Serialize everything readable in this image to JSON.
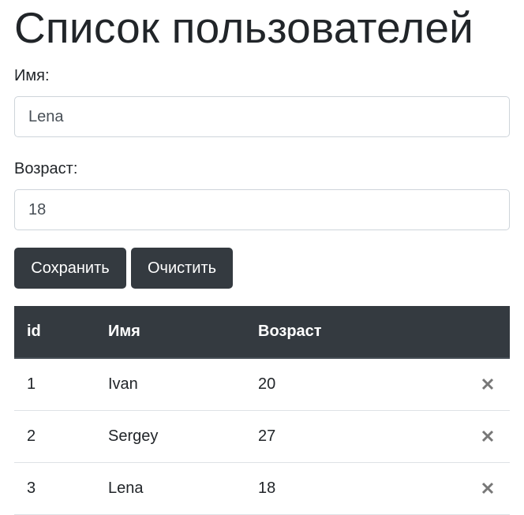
{
  "page": {
    "title": "Список пользователей"
  },
  "form": {
    "name_label": "Имя:",
    "name_value": "Lena",
    "age_label": "Возраст:",
    "age_value": "18"
  },
  "buttons": {
    "save_label": "Сохранить",
    "clear_label": "Очистить"
  },
  "table": {
    "headers": {
      "id": "id",
      "name": "Имя",
      "age": "Возраст"
    },
    "rows": [
      {
        "id": "1",
        "name": "Ivan",
        "age": "20",
        "action_icon": "close-icon"
      },
      {
        "id": "2",
        "name": "Sergey",
        "age": "27",
        "action_icon": "close-icon"
      },
      {
        "id": "3",
        "name": "Lena",
        "age": "18",
        "action_icon": "close-icon"
      }
    ]
  },
  "colors": {
    "dark": "#343a40",
    "icon": "#777777",
    "border": "#dee2e6"
  }
}
